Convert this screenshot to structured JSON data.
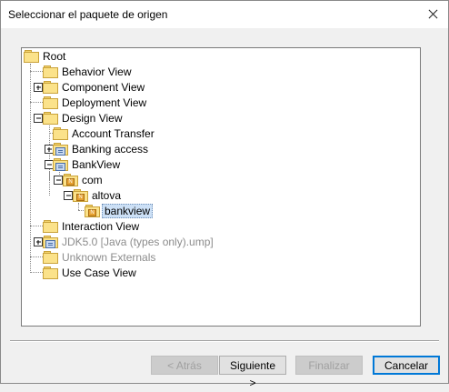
{
  "window": {
    "title": "Seleccionar el paquete de origen",
    "close_icon": "close-icon"
  },
  "tree": {
    "nodes": [
      {
        "label": "Root"
      },
      {
        "label": "Behavior View"
      },
      {
        "label": "Component View"
      },
      {
        "label": "Deployment View"
      },
      {
        "label": "Design View"
      },
      {
        "label": "Account Transfer"
      },
      {
        "label": "Banking access"
      },
      {
        "label": "BankView"
      },
      {
        "label": "com"
      },
      {
        "label": "altova"
      },
      {
        "label": "bankview"
      },
      {
        "label": "Interaction View"
      },
      {
        "label": "JDK5.0 [Java (types only).ump]"
      },
      {
        "label": "Unknown Externals"
      },
      {
        "label": "Use Case View"
      }
    ]
  },
  "buttons": {
    "back": "< Atrás",
    "next": "Siguiente >",
    "finish": "Finalizar",
    "cancel": "Cancelar"
  },
  "colors": {
    "selection": "#cce0f6",
    "folder": "#fbe28a",
    "default_button_border": "#0078d7"
  }
}
